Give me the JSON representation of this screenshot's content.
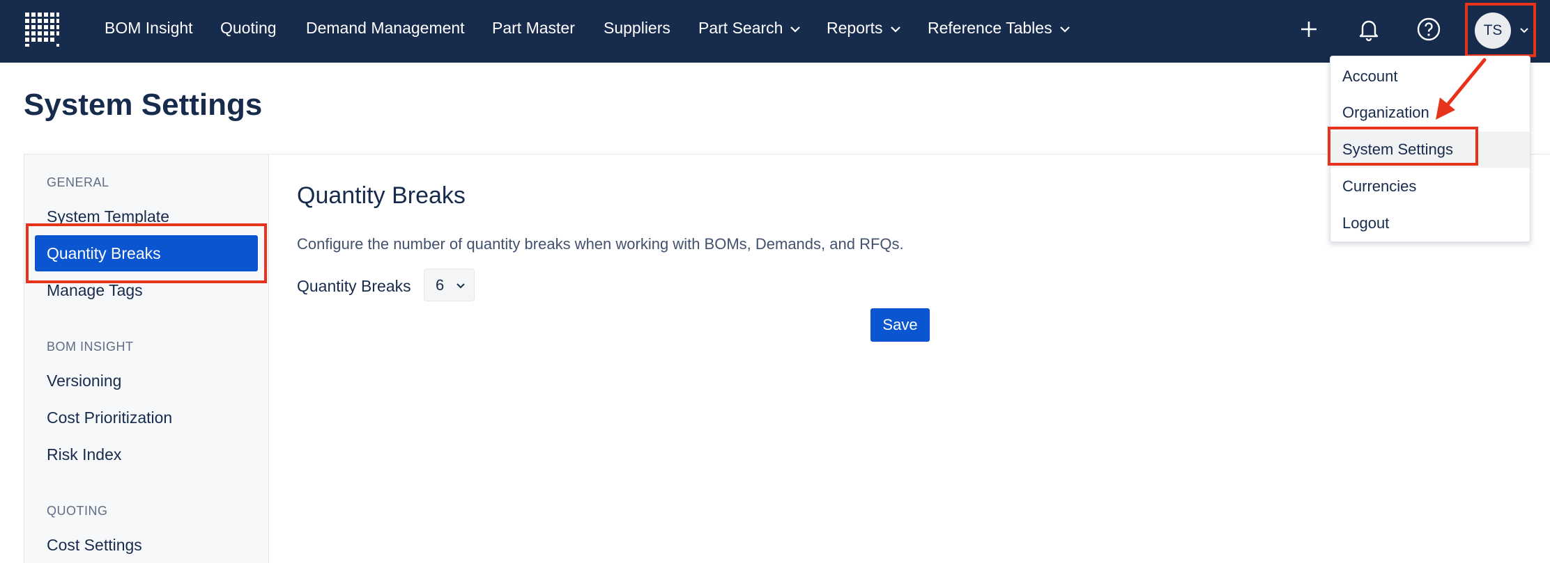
{
  "nav": {
    "items": [
      {
        "label": "BOM Insight",
        "has_dropdown": false
      },
      {
        "label": "Quoting",
        "has_dropdown": false
      },
      {
        "label": "Demand Management",
        "has_dropdown": false
      },
      {
        "label": "Part Master",
        "has_dropdown": false
      },
      {
        "label": "Suppliers",
        "has_dropdown": false
      },
      {
        "label": "Part Search",
        "has_dropdown": true
      },
      {
        "label": "Reports",
        "has_dropdown": true
      },
      {
        "label": "Reference Tables",
        "has_dropdown": true
      }
    ],
    "icons": [
      "grid-logo-icon",
      "plus-icon",
      "bell-icon",
      "help-icon"
    ],
    "avatar_initials": "TS"
  },
  "page": {
    "title": "System Settings"
  },
  "sidebar": {
    "sections": [
      {
        "heading": "GENERAL",
        "items": [
          "System Template",
          "Quantity Breaks",
          "Manage Tags"
        ]
      },
      {
        "heading": "BOM INSIGHT",
        "items": [
          "Versioning",
          "Cost Prioritization",
          "Risk Index"
        ]
      },
      {
        "heading": "QUOTING",
        "items": [
          "Cost Settings"
        ]
      }
    ],
    "active_item": "Quantity Breaks"
  },
  "main": {
    "title": "Quantity Breaks",
    "description": "Configure the number of quantity breaks when working with BOMs, Demands, and RFQs.",
    "field_label": "Quantity Breaks",
    "field_value": "6",
    "save_label": "Save"
  },
  "user_menu": {
    "items": [
      "Account",
      "Organization",
      "System Settings",
      "Currencies",
      "Logout"
    ],
    "highlighted": "System Settings"
  },
  "colors": {
    "nav_bg": "#172b4d",
    "primary": "#0b56d0",
    "annotation": "#e8331c"
  }
}
